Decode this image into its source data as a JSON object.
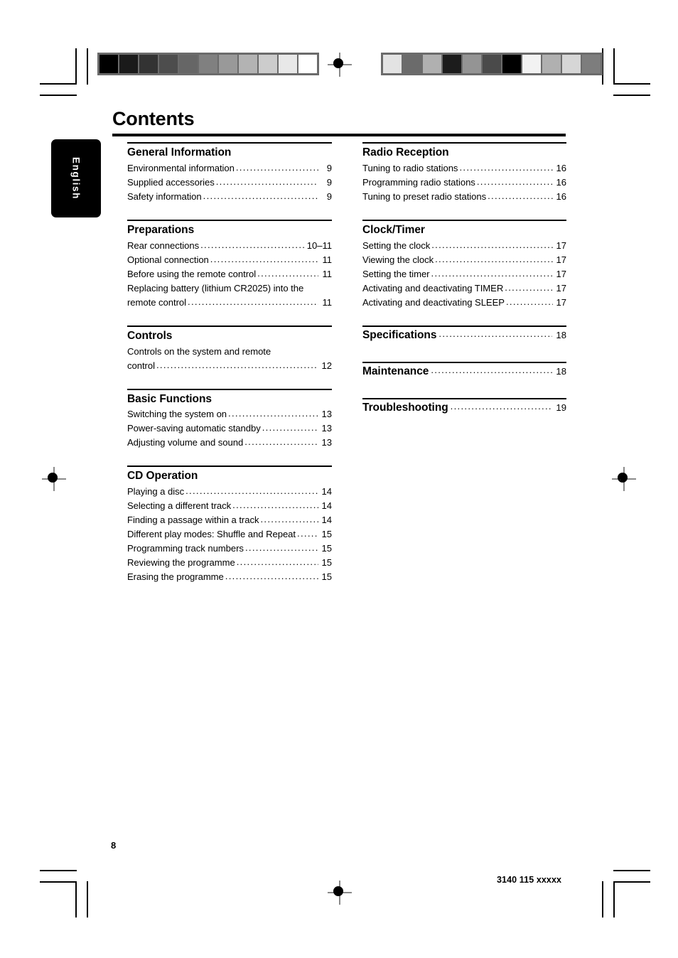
{
  "page": {
    "title": "Contents",
    "language_tab": "English",
    "folio": "8",
    "document_code": "3140 115 xxxxx"
  },
  "columns": {
    "left": [
      {
        "heading": "General Information",
        "entries": [
          {
            "label": "Environmental information",
            "page": "9"
          },
          {
            "label": "Supplied accessories",
            "page": "9"
          },
          {
            "label": "Safety information",
            "page": "9"
          }
        ]
      },
      {
        "heading": "Preparations",
        "entries": [
          {
            "label": "Rear connections",
            "page": "10–11"
          },
          {
            "label": "Optional connection",
            "page": "11"
          },
          {
            "label": "Before using the remote control",
            "page": "11"
          },
          {
            "label": "Replacing battery (lithium CR2025) into the",
            "continuation": "remote control",
            "page": "11"
          }
        ]
      },
      {
        "heading": "Controls",
        "entries": [
          {
            "label": "Controls on the system and remote",
            "continuation": "control",
            "page": "12"
          }
        ]
      },
      {
        "heading": "Basic Functions",
        "entries": [
          {
            "label": "Switching the system on",
            "page": "13"
          },
          {
            "label": "Power-saving automatic standby",
            "page": "13"
          },
          {
            "label": "Adjusting volume and sound",
            "page": "13"
          }
        ]
      },
      {
        "heading": "CD Operation",
        "entries": [
          {
            "label": "Playing a disc",
            "page": "14"
          },
          {
            "label": "Selecting a different track",
            "page": "14"
          },
          {
            "label": "Finding a passage within a track",
            "page": "14"
          },
          {
            "label": "Different play modes: Shuffle and Repeat",
            "page": "15"
          },
          {
            "label": "Programming track numbers",
            "page": "15"
          },
          {
            "label": "Reviewing the programme",
            "page": "15"
          },
          {
            "label": "Erasing the programme",
            "page": "15"
          }
        ]
      }
    ],
    "right": [
      {
        "heading": "Radio Reception",
        "entries": [
          {
            "label": "Tuning to radio stations",
            "page": "16"
          },
          {
            "label": "Programming radio stations",
            "page": "16"
          },
          {
            "label": "Tuning to preset radio stations",
            "page": "16"
          }
        ]
      },
      {
        "heading": "Clock/Timer",
        "entries": [
          {
            "label": "Setting the clock",
            "page": "17"
          },
          {
            "label": "Viewing the clock",
            "page": "17"
          },
          {
            "label": "Setting the timer",
            "page": "17"
          },
          {
            "label": "Activating and deactivating TIMER",
            "page": "17"
          },
          {
            "label": "Activating and deactivating SLEEP",
            "page": "17"
          }
        ]
      },
      {
        "heading": "Specifications",
        "heading_page": "18",
        "entries": []
      },
      {
        "heading": "Maintenance",
        "heading_page": "18",
        "entries": []
      },
      {
        "heading": "Troubleshooting",
        "heading_page": "19",
        "entries": []
      }
    ]
  },
  "print_marks": {
    "gray_strip_left": [
      "#000000",
      "#1a1a1a",
      "#333333",
      "#4d4d4d",
      "#666666",
      "#808080",
      "#999999",
      "#b3b3b3",
      "#cccccc",
      "#e8e8e8",
      "#ffffff"
    ],
    "gray_strip_right": [
      "#e3e3e3",
      "#6b6b6b",
      "#b0b0b0",
      "#1c1c1c",
      "#949494",
      "#4a4a4a",
      "#000000",
      "#f2f2f2",
      "#b0b0b0",
      "#d6d6d6",
      "#7d7d7d"
    ]
  }
}
